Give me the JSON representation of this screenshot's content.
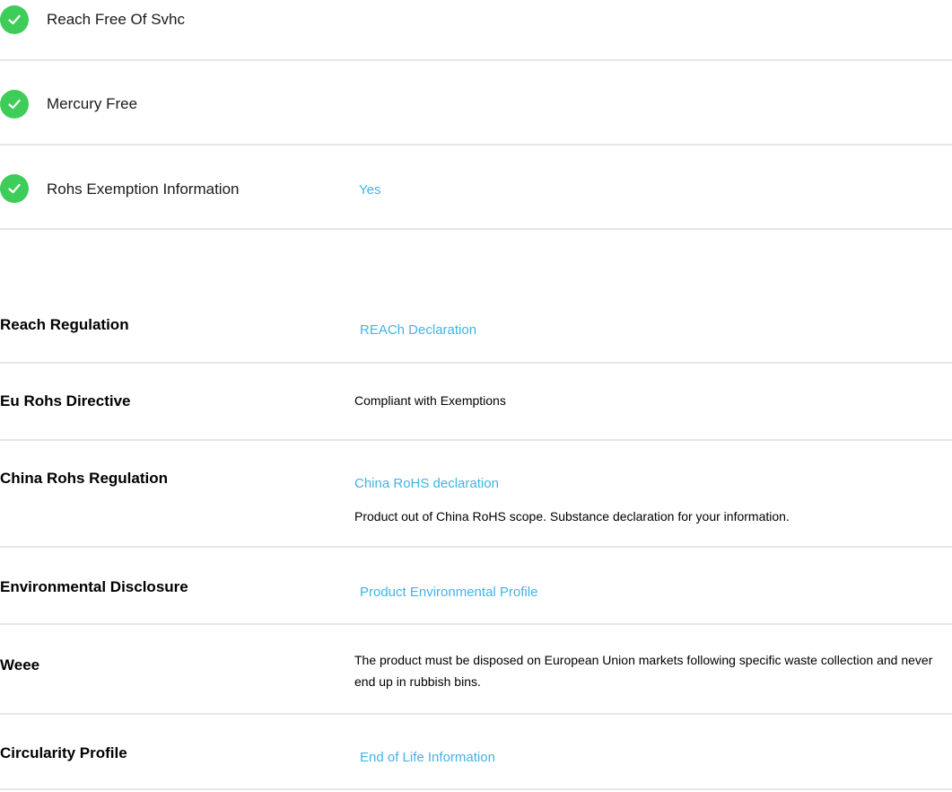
{
  "features": [
    {
      "label": "Reach Free Of Svhc",
      "value": ""
    },
    {
      "label": "Mercury Free",
      "value": ""
    },
    {
      "label": "Rohs Exemption Information",
      "value": "Yes"
    }
  ],
  "regulations": [
    {
      "label": "Reach Regulation",
      "link": "REACh Declaration"
    },
    {
      "label": "Eu Rohs Directive",
      "text": "Compliant with Exemptions"
    },
    {
      "label": "China Rohs Regulation",
      "link": "China RoHS declaration",
      "text": "Product out of China RoHS scope. Substance declaration for your information."
    },
    {
      "label": "Environmental Disclosure",
      "link": "Product Environmental Profile"
    },
    {
      "label": "Weee",
      "text": "The product must be disposed on European Union markets following specific waste collection and never end up in rubbish bins."
    },
    {
      "label": "Circularity Profile",
      "link": "End of Life Information"
    }
  ],
  "colors": {
    "check": "#3dcd58",
    "link": "#42b4e6",
    "divider": "#e6e6e6"
  },
  "icons": {
    "feature_status": "check-circle-icon"
  }
}
